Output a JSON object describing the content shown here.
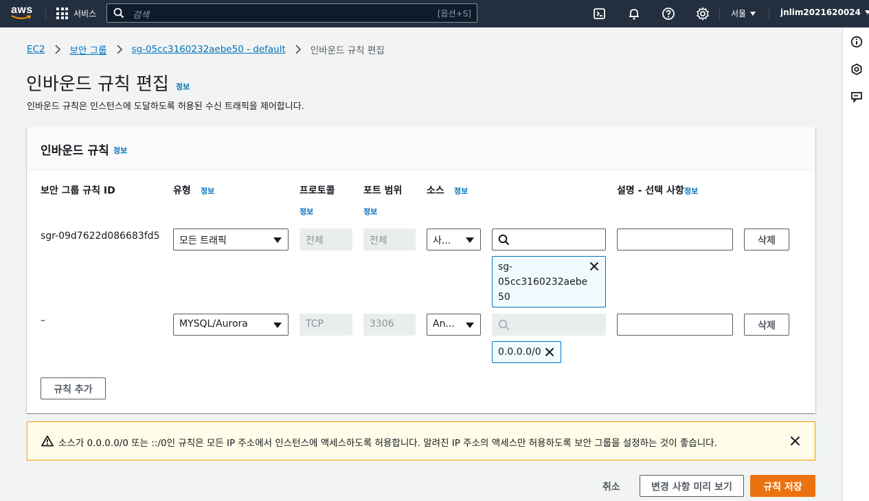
{
  "nav": {
    "logo": "aws",
    "services": "서비스",
    "search_placeholder": "검색",
    "search_shortcut": "[옵션+S]",
    "region": "서울",
    "user": "jnlim2021620024"
  },
  "breadcrumb": {
    "items": [
      "EC2",
      "보안 그룹",
      "sg-05cc3160232aebe50 - default"
    ],
    "current": "인바운드 규칙 편집"
  },
  "page": {
    "title": "인바운드 규칙 편집",
    "info": "정보",
    "description": "인바운드 규칙은 인스턴스에 도달하도록 허용된 수신 트래픽을 제어합니다."
  },
  "panel": {
    "title": "인바운드 규칙",
    "info": "정보",
    "columns": {
      "rule_id": "보안 그룹 규칙 ID",
      "type": "유형",
      "protocol": "프로토콜",
      "port_range": "포트 범위",
      "source": "소스",
      "description": "설명 - 선택 사항"
    },
    "rules": [
      {
        "id": "sgr-09d7622d086683fd5",
        "type": "모든 트래픽",
        "protocol": "전체",
        "port": "전체",
        "source_type": "사...",
        "token": "sg-\n05cc3160232aebe\n50",
        "delete": "삭제"
      },
      {
        "id": "–",
        "type": "MYSQL/Aurora",
        "protocol": "TCP",
        "port": "3306",
        "source_type": "An...",
        "token": "0.0.0.0/0",
        "delete": "삭제"
      }
    ],
    "add_rule": "규칙 추가"
  },
  "alert": {
    "message": "소스가 0.0.0.0/0 또는 ::/0인 규칙은 모든 IP 주소에서 인스턴스에 액세스하도록 허용합니다. 알려진 IP 주소의 액세스만 허용하도록 보안 그룹을 설정하는 것이 좋습니다."
  },
  "footer": {
    "cancel": "취소",
    "preview": "변경 사항 미리 보기",
    "save": "규칙 저장"
  },
  "colors": {
    "nav_bg": "#232f3e",
    "link": "#0073bb",
    "primary": "#ec7211",
    "warning_border": "#ff9900",
    "warning_bg": "#fffce9"
  }
}
